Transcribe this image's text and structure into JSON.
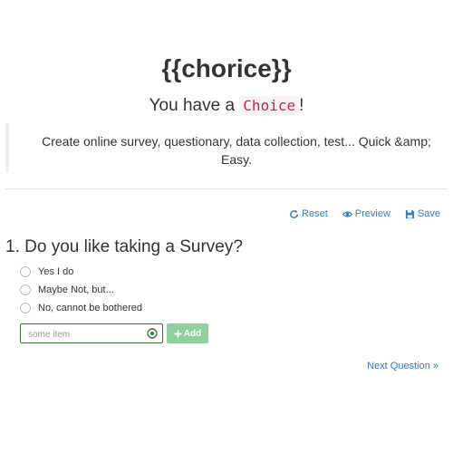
{
  "header": {
    "brand": "{{chorice}}",
    "tagline_prefix": "You have a ",
    "tagline_code": "Choice",
    "tagline_suffix": "!",
    "description": "Create online survey, questionary, data collection, test... Quick &amp; Easy."
  },
  "toolbar": {
    "reset": {
      "label": "Reset",
      "icon": "refresh-icon"
    },
    "preview": {
      "label": "Preview",
      "icon": "eye-icon"
    },
    "save": {
      "label": "Save",
      "icon": "floppy-icon"
    }
  },
  "question": {
    "number": "1.",
    "text": "Do you like taking a Survey?",
    "options": [
      {
        "label": "Yes I do"
      },
      {
        "label": "Maybe Not, but..."
      },
      {
        "label": "No, cannot be bothered"
      }
    ],
    "new_item": {
      "value": "",
      "placeholder": "some item",
      "icon": "ok-circle-icon"
    },
    "add_label": "Add",
    "add_icon": "plus-icon"
  },
  "navigation": {
    "next_label": "Next Question »"
  },
  "colors": {
    "link": "#337ab7",
    "code_text": "#c7254e",
    "code_bg": "#f9f2f4",
    "input_border": "#3c763d",
    "add_button": "#8fd19e"
  }
}
